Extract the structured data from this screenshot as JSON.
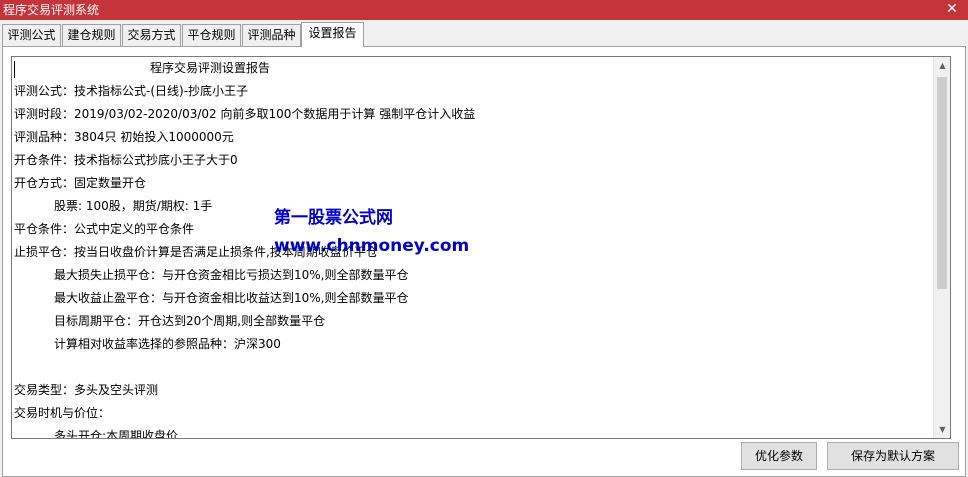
{
  "window": {
    "title": "程序交易评测系统",
    "close_glyph": "✕"
  },
  "tabs": [
    {
      "label": "评测公式"
    },
    {
      "label": "建仓规则"
    },
    {
      "label": "交易方式"
    },
    {
      "label": "平仓规则"
    },
    {
      "label": "评测品种"
    },
    {
      "label": "设置报告"
    }
  ],
  "active_tab": "设置报告",
  "report": {
    "title": "程序交易评测设置报告",
    "lines": [
      "评测公式：技术指标公式-(日线)-抄底小王子",
      "评测时段：2019/03/02-2020/03/02 向前多取100个数据用于计算 强制平仓计入收益",
      "评测品种：3804只 初始投入1000000元",
      "开仓条件：技术指标公式抄底小王子大于0",
      "开仓方式：固定数量开仓",
      "股票: 100股，期货/期权: 1手",
      "平仓条件：公式中定义的平仓条件",
      "止损平仓：按当日收盘价计算是否满足止损条件,按本周期收盘价平仓",
      "最大损失止损平仓：与开仓资金相比亏损达到10%,则全部数量平仓",
      "最大收益止盈平仓：与开仓资金相比收益达到10%,则全部数量平仓",
      "目标周期平仓：开仓达到20个周期,则全部数量平仓",
      "计算相对收益率选择的参照品种：沪深300",
      "交易类型：多头及空头评测",
      "交易时机与价位：",
      "多头开仓:本周期收盘价"
    ]
  },
  "watermark": {
    "line1": "第一股票公式网",
    "line2": "www.chnmoney.com"
  },
  "buttons": {
    "optimize": "优化参数",
    "save_default": "保存为默认方案"
  },
  "scrollbar": {
    "up_glyph": "▲",
    "down_glyph": "▼"
  },
  "colors": {
    "titlebar": "#c4343b",
    "watermark": "#0000cc"
  }
}
